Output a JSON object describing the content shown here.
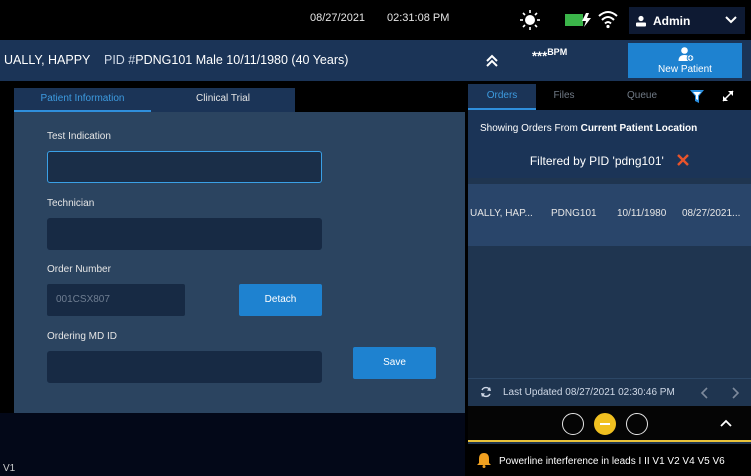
{
  "status_bar": {
    "date": "08/27/2021",
    "time": "02:31:08 PM",
    "user_label": "Admin"
  },
  "patient": {
    "name": "UALLY, HAPPY",
    "pid_label": "PID #",
    "pid": "PDNG101",
    "details": "Male 10/11/1980 (40 Years)",
    "bpm_value": "***",
    "bpm_unit": "BPM",
    "new_patient_label": "New Patient"
  },
  "left_tabs": [
    "Patient Information",
    "Clinical Trial"
  ],
  "form": {
    "test_indication_label": "Test Indication",
    "test_indication_value": "",
    "technician_label": "Technician",
    "technician_value": "",
    "order_number_label": "Order Number",
    "order_number_value": "001CSX807",
    "detach_label": "Detach",
    "ordering_md_label": "Ordering MD ID",
    "ordering_md_value": "",
    "save_label": "Save"
  },
  "version": "V1",
  "right_tabs": [
    "Orders",
    "Files",
    "Queue"
  ],
  "orders": {
    "showing_prefix": "Showing Orders From ",
    "showing_bold": "Current Patient Location",
    "filtered_text": "Filtered by PID 'pdng101'",
    "rows": [
      {
        "name": "UALLY, HAP...",
        "pid": "PDNG101",
        "dob": "10/11/1980",
        "date": "08/27/2021..."
      }
    ],
    "last_updated": "Last Updated 08/27/2021 02:30:46 PM"
  },
  "alert": {
    "text": "Powerline interference in leads I II V1 V2 V4 V5 V6"
  },
  "colors": {
    "accent": "#1e82d0",
    "banner": "#1b3457",
    "form_bg": "#2b4460",
    "warning": "#f0c020",
    "close_x": "#e8532b"
  }
}
